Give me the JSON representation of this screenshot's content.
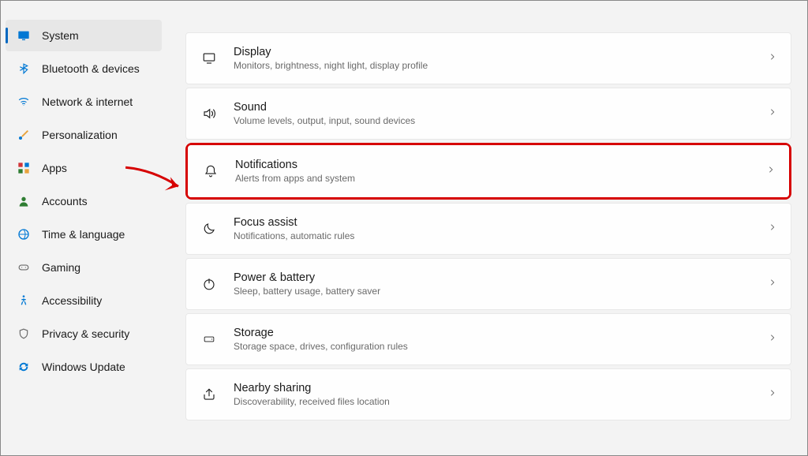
{
  "sidebar": {
    "items": [
      {
        "label": "System",
        "icon": "monitor",
        "color": "#0078d4",
        "active": true
      },
      {
        "label": "Bluetooth & devices",
        "icon": "bluetooth",
        "color": "#0078d4"
      },
      {
        "label": "Network & internet",
        "icon": "wifi",
        "color": "#0078d4"
      },
      {
        "label": "Personalization",
        "icon": "brush",
        "color": "#e8a33d"
      },
      {
        "label": "Apps",
        "icon": "grid",
        "color": "#d13438"
      },
      {
        "label": "Accounts",
        "icon": "person",
        "color": "#2e7d32"
      },
      {
        "label": "Time & language",
        "icon": "globe-clock",
        "color": "#0078d4"
      },
      {
        "label": "Gaming",
        "icon": "gamepad",
        "color": "#6b6b6b"
      },
      {
        "label": "Accessibility",
        "icon": "accessibility",
        "color": "#0078d4"
      },
      {
        "label": "Privacy & security",
        "icon": "shield",
        "color": "#6b6b6b"
      },
      {
        "label": "Windows Update",
        "icon": "update",
        "color": "#0078d4"
      }
    ]
  },
  "settings": [
    {
      "title": "Display",
      "desc": "Monitors, brightness, night light, display profile",
      "icon": "display"
    },
    {
      "title": "Sound",
      "desc": "Volume levels, output, input, sound devices",
      "icon": "sound"
    },
    {
      "title": "Notifications",
      "desc": "Alerts from apps and system",
      "icon": "bell",
      "highlighted": true
    },
    {
      "title": "Focus assist",
      "desc": "Notifications, automatic rules",
      "icon": "moon"
    },
    {
      "title": "Power & battery",
      "desc": "Sleep, battery usage, battery saver",
      "icon": "power"
    },
    {
      "title": "Storage",
      "desc": "Storage space, drives, configuration rules",
      "icon": "storage"
    },
    {
      "title": "Nearby sharing",
      "desc": "Discoverability, received files location",
      "icon": "share"
    }
  ]
}
